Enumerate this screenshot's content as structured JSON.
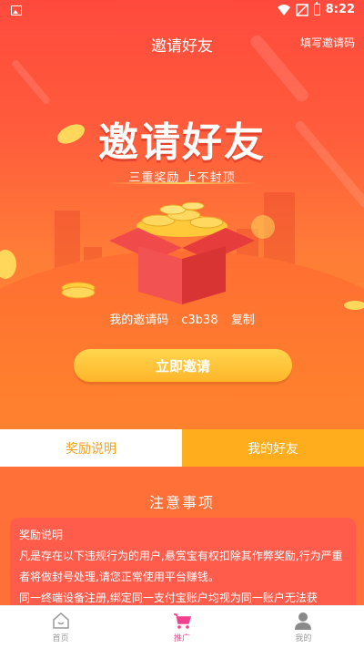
{
  "statusbar": {
    "time": "8:22"
  },
  "header": {
    "title": "邀请好友",
    "fill_code_label": "填写邀请码"
  },
  "hero": {
    "big_title": "邀请好友",
    "subtitle": "三重奖励 上不封顶",
    "invite_code_label": "我的邀请码",
    "invite_code": "c3b38",
    "copy_label": "复制",
    "invite_button": "立即邀请"
  },
  "tabs": [
    {
      "label": "奖励说明",
      "active": true
    },
    {
      "label": "我的好友",
      "active": false
    }
  ],
  "notice": {
    "title": "注意事项",
    "heading": "奖励说明",
    "paragraph1": "凡是存在以下违规行为的用户,悬赏宝有权扣除其作弊奖励,行为严重者将做封号处理,请您正常使用平台赚钱。",
    "paragraph2": "同一终端设备注册,绑定同一支付宝账户均视为同一账户无法获"
  },
  "bottom_nav": [
    {
      "label": "首页",
      "icon": "home-icon",
      "active": false
    },
    {
      "label": "推广",
      "icon": "cart-icon",
      "active": true
    },
    {
      "label": "我的",
      "icon": "user-icon",
      "active": false
    }
  ],
  "colors": {
    "primary_red": "#ff4a3d",
    "orange": "#ff8a2f",
    "gold_button": "#ffc23a",
    "tab_active_text": "#f3a21b",
    "tab_inactive_bg": "#ffad1c",
    "nav_active": "#f0418f"
  }
}
